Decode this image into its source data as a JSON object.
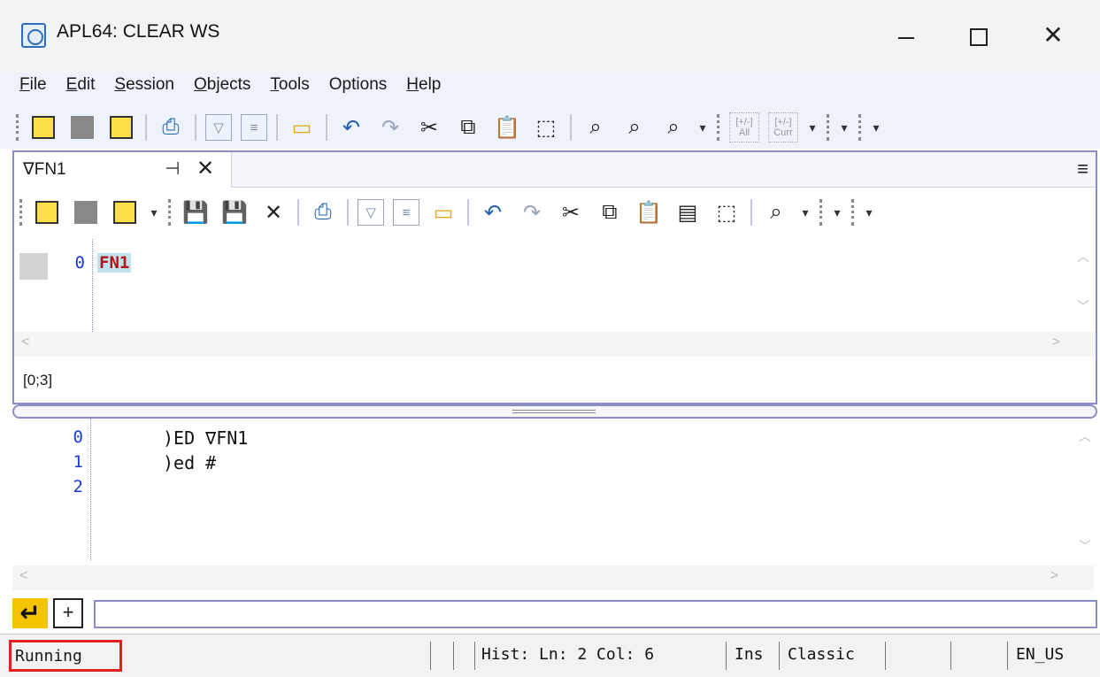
{
  "window": {
    "title": "APL64: CLEAR WS",
    "controls": {
      "minimize": "—",
      "maximize": "☐",
      "close": "✕"
    }
  },
  "menu": {
    "items": [
      {
        "label": "File",
        "u": "F",
        "rest": "ile"
      },
      {
        "label": "Edit",
        "u": "E",
        "rest": "dit"
      },
      {
        "label": "Session",
        "u": "S",
        "rest": "ession"
      },
      {
        "label": "Objects",
        "u": "O",
        "rest": "bjects"
      },
      {
        "label": "Tools",
        "u": "T",
        "rest": "ools"
      },
      {
        "label": "Options",
        "u": "",
        "rest": "Options"
      },
      {
        "label": "Help",
        "u": "H",
        "rest": "elp"
      }
    ]
  },
  "toolbar_main": {
    "icons": [
      "new-editor-icon",
      "editor-window-icon",
      "yellow-window-icon",
      "print-icon",
      "triangle-icon",
      "document-icon",
      "open-folder-icon",
      "undo-icon",
      "redo-icon",
      "cut-icon",
      "copy-icon",
      "paste-icon",
      "select-icon",
      "find-icon",
      "find-previous-icon",
      "find-next-icon",
      "comment-all-icon",
      "comment-current-icon"
    ],
    "comment_all_text": "[+/-]\nAll",
    "comment_current_text": "[+/-]\nCurr"
  },
  "editor": {
    "tab_label": "∇FN1",
    "line_number": "0",
    "line_text": "FN1",
    "position": "[0;3]"
  },
  "session": {
    "lines": [
      {
        "num": "0",
        "text": ")ED ∇FN1"
      },
      {
        "num": "1",
        "text": ")ed #"
      },
      {
        "num": "2",
        "text": ""
      }
    ]
  },
  "input": {
    "value": ""
  },
  "statusbar": {
    "state": "Running",
    "hist": "Hist: Ln: 2 Col: 6",
    "mode": "Ins",
    "keyboard": "Classic",
    "locale": "EN_US"
  },
  "colors": {
    "accent_border": "#8c8cc8",
    "line_number": "#1a3ad6",
    "function_name": "#b01818",
    "highlight": "#e02020",
    "enter_button": "#f5c400"
  }
}
